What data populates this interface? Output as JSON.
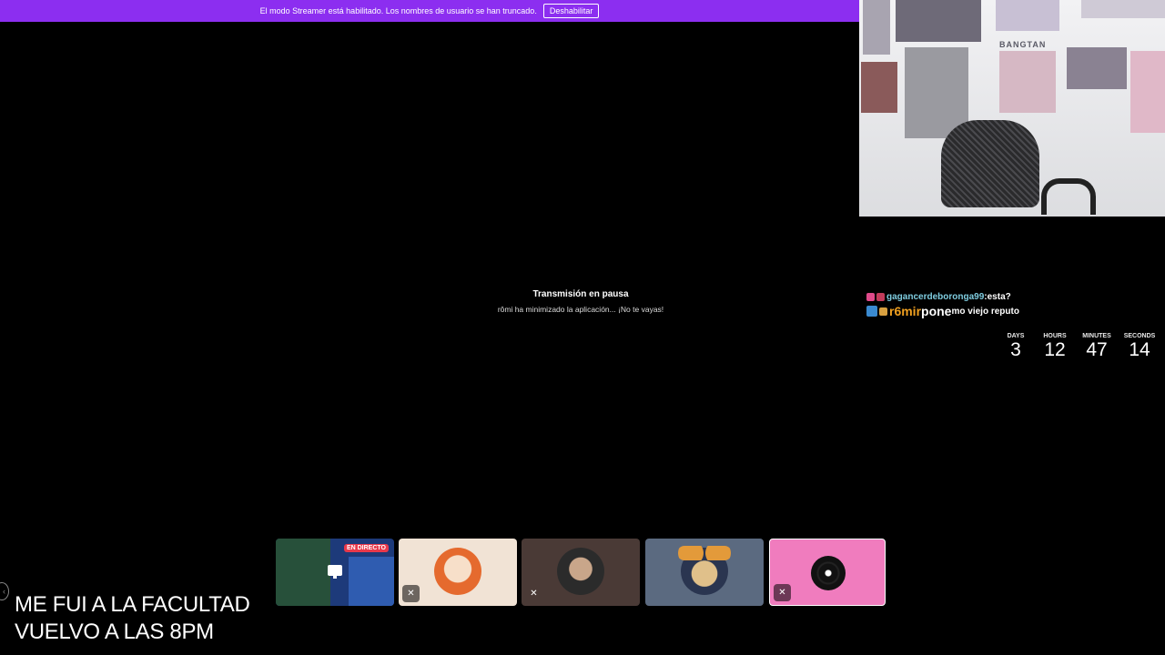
{
  "banner": {
    "message": "El modo Streamer está habilitado. Los nombres de usuario se han truncado.",
    "disable_label": "Deshabilitar"
  },
  "stream": {
    "paused_title": "Transmisión en pausa",
    "paused_subtitle": "rômi ha minimizado la aplicación... ¡No te vayas!"
  },
  "webcam": {
    "wall_text": "BANGTAN"
  },
  "chat": {
    "messages": [
      {
        "user": "gagancerdeboronga99",
        "sep": ": ",
        "text": "esta?"
      },
      {
        "user": "r6mir",
        "sep": " ",
        "text": "pone",
        "trailing": "mo viejo reputo"
      }
    ]
  },
  "countdown": {
    "labels": [
      "DAYS",
      "HOURS",
      "MINUTES",
      "SECONDS"
    ],
    "values": [
      "3",
      "12",
      "47",
      "14"
    ]
  },
  "participants": {
    "live_badge": "EN DIRECTO"
  },
  "overlay": {
    "line1": "ME FUI A LA FACULTAD",
    "line2": "VUELVO A LAS 8PM"
  },
  "colors": {
    "banner": "#8c2ef0",
    "live": "#e8394b",
    "music_tile": "#f07cbe"
  }
}
